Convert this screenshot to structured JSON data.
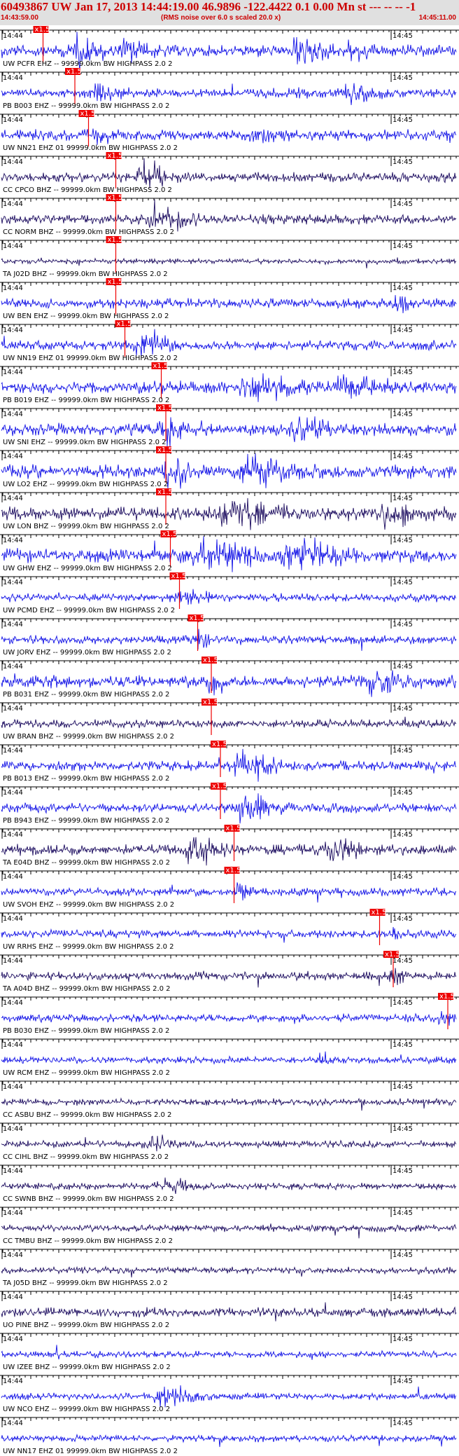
{
  "header": {
    "title": "60493867 UW Jan 17, 2013 14:44:19.00   46.9896 -122.4422  0.1 0.00 Mn st --- -- --  -1",
    "start_time": "14:43:59.00",
    "rms_note": "(RMS noise over 6.0 s scaled 20.0 x)",
    "end_time": "14:45:11.00"
  },
  "colors": {
    "header_text": "#cc0000",
    "header_bg": "#e0e0e0",
    "trace_blue": "#1010e6",
    "trace_navy": "#1a0a5e",
    "pick": "#ee0000",
    "axis": "#000000"
  },
  "chart_data": {
    "type": "line",
    "x_tick_labels": [
      "14:44",
      "14:45"
    ],
    "traces": [
      {
        "label": "UW PCFR EHZ -- 99999.0km BW  HIGHPASS  2.0  2",
        "pick": "x1.5",
        "pick_t": 0.07,
        "color": "blue",
        "amp": 0.45,
        "bursts": [
          [
            0.16,
            0.05,
            1.0
          ],
          [
            0.27,
            0.04,
            0.6
          ],
          [
            0.65,
            0.05,
            0.95
          ],
          [
            0.77,
            0.035,
            0.7
          ]
        ]
      },
      {
        "label": "PB B003 EHZ -- 99999.0km BW  HIGHPASS  2.0  2",
        "pick": "x1.5",
        "pick_t": 0.14,
        "color": "blue",
        "amp": 0.35,
        "bursts": [
          [
            0.2,
            0.05,
            0.4
          ],
          [
            0.76,
            0.05,
            0.5
          ]
        ]
      },
      {
        "label": "UW NN21 EHZ 01 99999.0km BW  HIGHPASS  2.0  2",
        "pick": "x1.5",
        "pick_t": 0.17,
        "color": "blue",
        "amp": 0.4,
        "bursts": [
          [
            0.21,
            0.03,
            0.5
          ],
          [
            0.55,
            0.04,
            0.35
          ]
        ]
      },
      {
        "label": "CC CPCO BHZ -- 99999.0km BW  HIGHPASS  2.0  2",
        "pick": "x1.5",
        "pick_t": 0.23,
        "color": "navy",
        "amp": 0.35,
        "bursts": [
          [
            0.31,
            0.05,
            1.0
          ]
        ]
      },
      {
        "label": "CC NORM BHZ -- 99999.0km BW  HIGHPASS  2.0  2",
        "pick": "x1.5",
        "pick_t": 0.23,
        "color": "navy",
        "amp": 0.35,
        "bursts": [
          [
            0.33,
            0.07,
            1.0
          ]
        ]
      },
      {
        "label": "TA J02D BHZ -- 99999.0km BW  HIGHPASS  2.0  2",
        "pick": "x1.5",
        "pick_t": 0.23,
        "color": "navy",
        "amp": 0.2,
        "bursts": []
      },
      {
        "label": "UW BEN EHZ -- 99999.0km BW  HIGHPASS  2.0  2",
        "pick": "x1.5",
        "pick_t": 0.23,
        "color": "blue",
        "amp": 0.35,
        "bursts": [
          [
            0.87,
            0.03,
            0.45
          ]
        ]
      },
      {
        "label": "UW NN19 EHZ 01 99999.0km BW  HIGHPASS  2.0  2",
        "pick": "x1.5",
        "pick_t": 0.25,
        "color": "blue",
        "amp": 0.35,
        "bursts": [
          [
            0.31,
            0.05,
            1.0
          ]
        ]
      },
      {
        "label": "PB B019 EHZ -- 99999.0km BW  HIGHPASS  2.0  2",
        "pick": "x1.5",
        "pick_t": 0.33,
        "color": "blue",
        "amp": 0.45,
        "bursts": [
          [
            0.55,
            0.08,
            0.9
          ],
          [
            0.75,
            0.06,
            0.7
          ]
        ]
      },
      {
        "label": "UW SNI EHZ -- 99999.0km BW  HIGHPASS  2.0  2",
        "pick": "x1.5",
        "pick_t": 0.34,
        "color": "blue",
        "amp": 0.45,
        "bursts": [
          [
            0.36,
            0.03,
            1.0
          ],
          [
            0.65,
            0.06,
            0.7
          ]
        ]
      },
      {
        "label": "UW LO2 EHZ -- 99999.0km BW  HIGHPASS  2.0  2",
        "pick": "x1.5",
        "pick_t": 0.34,
        "color": "blue",
        "amp": 0.5,
        "bursts": [
          [
            0.37,
            0.04,
            0.9
          ],
          [
            0.55,
            0.08,
            0.8
          ]
        ]
      },
      {
        "label": "UW LON BHZ -- 99999.0km BW  HIGHPASS  2.0  2",
        "pick": "x1.5",
        "pick_t": 0.34,
        "color": "navy",
        "amp": 0.5,
        "bursts": [
          [
            0.5,
            0.1,
            0.8
          ],
          [
            0.85,
            0.06,
            0.7
          ]
        ]
      },
      {
        "label": "UW GHW EHZ -- 99999.0km BW  HIGHPASS  2.0  2",
        "pick": "x1.5",
        "pick_t": 0.35,
        "color": "blue",
        "amp": 0.5,
        "bursts": [
          [
            0.45,
            0.1,
            1.0
          ],
          [
            0.65,
            0.08,
            0.9
          ]
        ]
      },
      {
        "label": "UW PCMD EHZ -- 99999.0km BW  HIGHPASS  2.0  2",
        "pick": "x1.5",
        "pick_t": 0.37,
        "color": "blue",
        "amp": 0.3,
        "bursts": [
          [
            0.4,
            0.05,
            0.5
          ]
        ]
      },
      {
        "label": "UW JORV EHZ -- 99999.0km BW  HIGHPASS  2.0  2",
        "pick": "x1.5",
        "pick_t": 0.41,
        "color": "blue",
        "amp": 0.3,
        "bursts": [
          [
            0.43,
            0.02,
            0.9
          ]
        ]
      },
      {
        "label": "PB B031 EHZ -- 99999.0km BW  HIGHPASS  2.0  2",
        "pick": "x1.5",
        "pick_t": 0.44,
        "color": "blue",
        "amp": 0.45,
        "bursts": [
          [
            0.46,
            0.03,
            0.8
          ],
          [
            0.82,
            0.04,
            1.0
          ]
        ]
      },
      {
        "label": "UW BRAN BHZ -- 99999.0km BW  HIGHPASS  2.0  2",
        "pick": "x1.5",
        "pick_t": 0.44,
        "color": "navy",
        "amp": 0.3,
        "bursts": []
      },
      {
        "label": "PB B013 EHZ -- 99999.0km BW  HIGHPASS  2.0  2",
        "pick": "x1.5",
        "pick_t": 0.46,
        "color": "blue",
        "amp": 0.35,
        "bursts": [
          [
            0.53,
            0.06,
            1.0
          ]
        ]
      },
      {
        "label": "PB B943 EHZ -- 99999.0km BW  HIGHPASS  2.0  2",
        "pick": "x1.5",
        "pick_t": 0.46,
        "color": "blue",
        "amp": 0.35,
        "bursts": [
          [
            0.53,
            0.06,
            1.0
          ]
        ]
      },
      {
        "label": "TA E04D BHZ -- 99999.0km BW  HIGHPASS  2.0  2",
        "pick": "x1.5",
        "pick_t": 0.49,
        "color": "navy",
        "amp": 0.4,
        "bursts": [
          [
            0.42,
            0.06,
            0.8
          ],
          [
            0.73,
            0.05,
            1.0
          ]
        ]
      },
      {
        "label": "UW SVOH EHZ -- 99999.0km BW  HIGHPASS  2.0  2",
        "pick": "x1.5",
        "pick_t": 0.49,
        "color": "blue",
        "amp": 0.3,
        "bursts": [
          [
            0.52,
            0.02,
            0.7
          ]
        ]
      },
      {
        "label": "UW RRHS EHZ -- 99999.0km BW  HIGHPASS  2.0  2",
        "pick": "x1.5",
        "pick_t": 0.81,
        "color": "blue",
        "amp": 0.3,
        "bursts": [
          [
            0.86,
            0.015,
            0.8
          ]
        ]
      },
      {
        "label": "TA A04D BHZ -- 99999.0km BW  HIGHPASS  2.0  2",
        "pick": "x1.5",
        "pick_t": 0.84,
        "color": "navy",
        "amp": 0.3,
        "bursts": [
          [
            0.86,
            0.02,
            0.7
          ]
        ]
      },
      {
        "label": "PB B030 EHZ -- 99999.0km BW  HIGHPASS  2.0  2",
        "pick": "x1.5",
        "pick_t": 0.96,
        "color": "blue",
        "amp": 0.3,
        "bursts": [
          [
            0.97,
            0.02,
            0.8
          ]
        ]
      },
      {
        "label": "UW RCM EHZ -- 99999.0km BW  HIGHPASS  2.0  2",
        "pick": "",
        "pick_t": null,
        "color": "blue",
        "amp": 0.25,
        "bursts": [
          [
            0.7,
            0.02,
            0.5
          ]
        ]
      },
      {
        "label": "CC ASBU BHZ -- 99999.0km BW  HIGHPASS  2.0  2",
        "pick": "",
        "pick_t": null,
        "color": "navy",
        "amp": 0.25,
        "bursts": []
      },
      {
        "label": "CC CIHL BHZ -- 99999.0km BW  HIGHPASS  2.0  2",
        "pick": "",
        "pick_t": null,
        "color": "navy",
        "amp": 0.25,
        "bursts": [
          [
            0.33,
            0.05,
            0.5
          ]
        ]
      },
      {
        "label": "CC SWNB BHZ -- 99999.0km BW  HIGHPASS  2.0  2",
        "pick": "",
        "pick_t": null,
        "color": "navy",
        "amp": 0.25,
        "bursts": [
          [
            0.36,
            0.05,
            0.5
          ]
        ]
      },
      {
        "label": "CC TMBU BHZ -- 99999.0km BW  HIGHPASS  2.0  2",
        "pick": "",
        "pick_t": null,
        "color": "navy",
        "amp": 0.25,
        "bursts": []
      },
      {
        "label": "TA J05D BHZ -- 99999.0km BW  HIGHPASS  2.0  2",
        "pick": "",
        "pick_t": null,
        "color": "navy",
        "amp": 0.25,
        "bursts": []
      },
      {
        "label": "UO PINE BHZ -- 99999.0km BW  HIGHPASS  2.0  2",
        "pick": "",
        "pick_t": null,
        "color": "navy",
        "amp": 0.35,
        "bursts": []
      },
      {
        "label": "UW IZEE BHZ -- 99999.0km BW  HIGHPASS  2.0  2",
        "pick": "",
        "pick_t": null,
        "color": "blue",
        "amp": 0.25,
        "bursts": []
      },
      {
        "label": "UW NCO EHZ -- 99999.0km BW  HIGHPASS  2.0  2",
        "pick": "",
        "pick_t": null,
        "color": "blue",
        "amp": 0.25,
        "bursts": [
          [
            0.35,
            0.06,
            0.8
          ]
        ]
      },
      {
        "label": "UW NN17 EHZ 01 99999.0km BW  HIGHPASS  2.0  2",
        "pick": "",
        "pick_t": null,
        "color": "blue",
        "amp": 0.25,
        "bursts": []
      }
    ]
  }
}
